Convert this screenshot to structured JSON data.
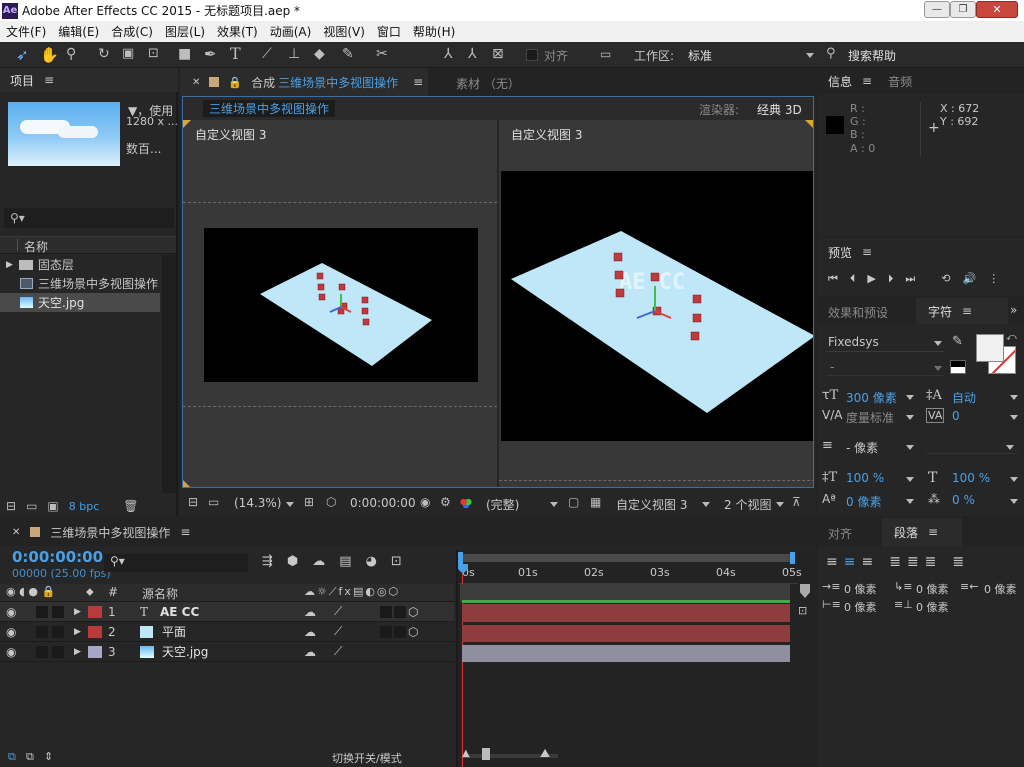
{
  "titlebar": {
    "icon": "Ae",
    "title": "Adobe After Effects CC 2015 - 无标题项目.aep *"
  },
  "menu": [
    "文件(F)",
    "编辑(E)",
    "合成(C)",
    "图层(L)",
    "效果(T)",
    "动画(A)",
    "视图(V)",
    "窗口",
    "帮助(H)"
  ],
  "toolbar": {
    "snap_label": "对齐",
    "workspace_label": "工作区:",
    "workspace_value": "标准",
    "search_placeholder": "搜索帮助"
  },
  "project": {
    "title": "项目",
    "preview_info": [
      "▼，使用",
      "1280 x ...",
      "数百..."
    ],
    "col_name": "名称",
    "items": [
      "固态层",
      "三维场景中多视图操作",
      "天空.jpg"
    ],
    "bpc": "8 bpc"
  },
  "comp": {
    "tab_label": "合成",
    "tab_name": "三维场景中多视图操作",
    "footage_tab": "素材 （无）",
    "breadcrumb": "三维场景中多视图操作",
    "renderer_label": "渲染器:",
    "renderer_value": "经典 3D",
    "view_left": "自定义视图 3",
    "view_right": "自定义视图 3",
    "zoom": "(14.3%)",
    "time": "0:00:00:00",
    "quality": "(完整)",
    "active_view": "自定义视图 3",
    "view_layout": "2 个视图"
  },
  "info": {
    "tab_info": "信息",
    "tab_audio": "音频",
    "r": "R :",
    "g": "G :",
    "b": "B :",
    "a": "A : 0",
    "x": "X : 672",
    "y": "Y : 692"
  },
  "preview": {
    "title": "预览"
  },
  "character": {
    "tab_effects": "效果和预设",
    "tab_char": "字符",
    "font": "Fixedsys",
    "style": "-",
    "size": "300 像素",
    "leading": "自动",
    "kerning": "度量标准",
    "tracking": "0",
    "stroke": "- 像素",
    "vscale": "100 %",
    "hscale": "100 %",
    "baseline": "0 像素",
    "tsume": "0 %"
  },
  "paragraph": {
    "tab_align": "对齐",
    "tab_para": "段落",
    "indent_left": "0 像素",
    "indent_first": "0 像素",
    "indent_right": "0 像素",
    "space_before": "0 像素",
    "space_after": "0 像素"
  },
  "timeline": {
    "comp_name": "三维场景中多视图操作",
    "timecode": "0:00:00:00",
    "frames": "00000 (25.00 fps)",
    "col_num": "#",
    "col_source": "源名称",
    "toggle_label": "切换开关/模式",
    "ruler": [
      "0s",
      "01s",
      "02s",
      "03s",
      "04s",
      "05s"
    ],
    "layers": [
      {
        "num": "1",
        "name": "AE CC",
        "color": "#b83a3a",
        "bar": "#8e3d3f"
      },
      {
        "num": "2",
        "name": "平面",
        "color": "#b83a3a",
        "bar": "#8e3d3f"
      },
      {
        "num": "3",
        "name": "天空.jpg",
        "color": "#a8a6c8",
        "bar": "#8f8fa0"
      }
    ]
  },
  "colors": {
    "accent": "#4aa0e6",
    "comp_bg": "#3a3a3a",
    "plane": "#bfe7f7"
  }
}
